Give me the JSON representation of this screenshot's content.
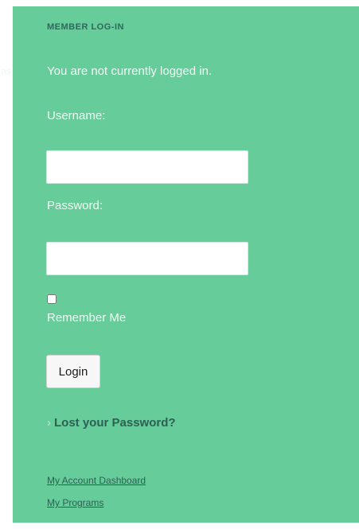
{
  "sidebar_cut_text": "as",
  "widget": {
    "heading": "MEMBER LOG-IN",
    "status": "You are not currently logged in.",
    "username_label": "Username:",
    "username_value": "",
    "password_label": "Password:",
    "password_value": "",
    "remember_label": "Remember Me",
    "remember_checked": false,
    "login_button": "Login",
    "lost_password_bullet": "›",
    "lost_password_link": "Lost your Password?",
    "account_links": [
      {
        "label": "My Account Dashboard"
      },
      {
        "label": "My Programs"
      }
    ]
  },
  "colors": {
    "panel_bg": "#66cc99",
    "heading_text": "#2d6a5a",
    "link_text": "#2d5f54",
    "light_text": "#f2fbf6"
  }
}
